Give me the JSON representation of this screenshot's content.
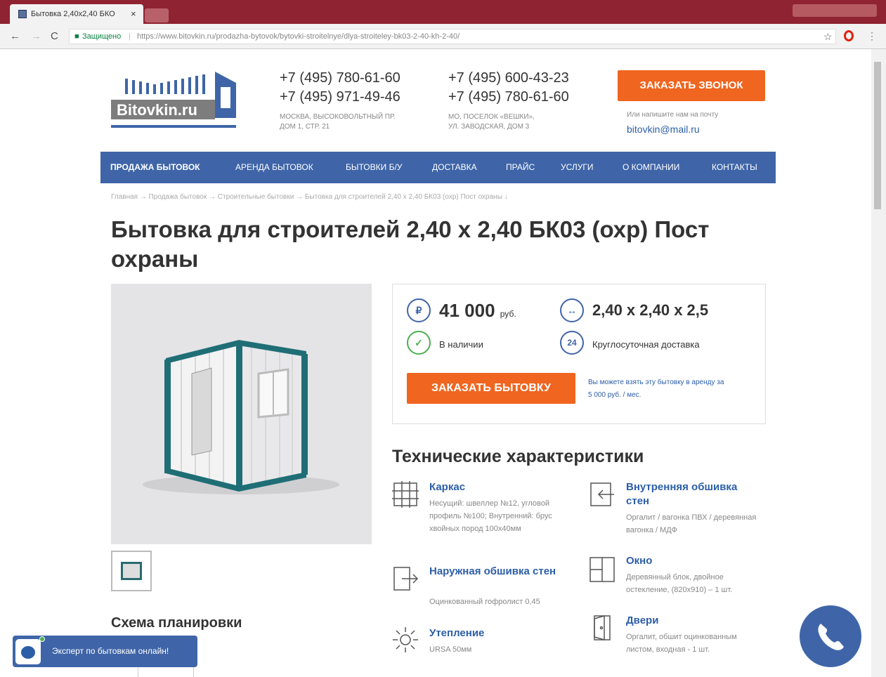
{
  "browser": {
    "tab_title": "Бытовка 2,40х2,40 БКО",
    "tab_close": "×",
    "secure_label": "Защищено",
    "url_separator": "|",
    "url": "https://www.bitovkin.ru/prodazha-bytovok/bytovki-stroitelnye/dlya-stroiteley-bk03-2-40-kh-2-40/",
    "back": "←",
    "forward": "→",
    "reload": "C",
    "star": "☆",
    "menu": "⋮"
  },
  "header": {
    "logo_text": "Bitovkin.ru",
    "phones_col1": [
      "+7 (495) 780-61-60",
      "+7 (495) 971-49-46"
    ],
    "address_col1": [
      "МОСКВА, ВЫСОКОВОЛЬТНЫЙ ПР.",
      "ДОМ 1, СТР. 21"
    ],
    "phones_col2": [
      "+7 (495) 600-43-23",
      "+7 (495) 780-61-60"
    ],
    "address_col2": [
      "МО, ПОСЕЛОК «ВЕШКИ»,",
      "УЛ. ЗАВОДСКАЯ, ДОМ 3"
    ],
    "call_button": "ЗАКАЗАТЬ ЗВОНОК",
    "mail_hint": "Или напишите нам на почту",
    "email": "bitovkin@mail.ru"
  },
  "nav": {
    "items": [
      "ПРОДАЖА БЫТОВОК",
      "АРЕНДА БЫТОВОК",
      "БЫТОВКИ Б/У",
      "ДОСТАВКА",
      "ПРАЙС",
      "УСЛУГИ",
      "О КОМПАНИИ",
      "КОНТАКТЫ"
    ]
  },
  "breadcrumb": "Главная → Продажа бытовок → Строительные бытовки → Бытовка для строителей 2,40 х 2,40 БК03 (охр) Пост охраны ↓",
  "product": {
    "title": "Бытовка для строителей 2,40 х 2,40 БК03 (охр) Пост охраны",
    "price": "41 000",
    "price_unit": "руб.",
    "price_icon": "₽",
    "dims": "2,40 x 2,40 x 2,5",
    "dims_icon": "↔",
    "stock": "В наличии",
    "stock_icon": "✓",
    "delivery": "Круглосуточная доставка",
    "delivery_icon": "24",
    "order_button": "ЗАКАЗАТЬ БЫТОВКУ",
    "rent_note": "Вы можете взять эту бытовку в аренду за 5 000 руб. / мес."
  },
  "tech": {
    "heading": "Технические характеристики",
    "specs": [
      {
        "title": "Каркас",
        "desc": "Несущий: швеллер №12, угловой профиль №100; Внутренний: брус хвойных пород 100х40мм"
      },
      {
        "title": "Внутренняя обшивка стен",
        "desc": "Оргалит / вагонка ПВХ / деревянная вагонка / МДФ"
      },
      {
        "title": "Наружная обшивка стен",
        "desc": "Оцинкованный гофролист 0,45"
      },
      {
        "title": "Окно",
        "desc": "Деревянный блок, двойное остекление, (820х910) – 1 шт."
      },
      {
        "title": "Утепление",
        "desc": "URSA 50мм"
      },
      {
        "title": "Двери",
        "desc": "Оргалит, обшит оцинкованным листом, входная - 1 шт."
      }
    ]
  },
  "plan_heading": "Схема планировки",
  "chat_text": "Эксперт по бытовкам онлайн!",
  "colors": {
    "accent": "#f0651f",
    "nav": "#3f65a8",
    "link": "#2c5ea8"
  }
}
